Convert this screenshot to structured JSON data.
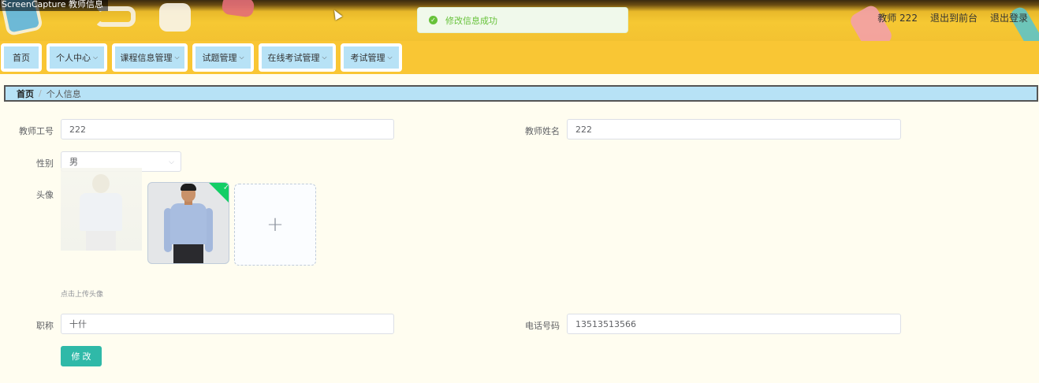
{
  "window": {
    "title": "ScreenCapture 教师信息"
  },
  "toast": {
    "message": "修改信息成功"
  },
  "header": {
    "links": [
      "教师 222",
      "退出到前台",
      "退出登录"
    ]
  },
  "nav": {
    "items": [
      {
        "label": "首页",
        "has_dropdown": false
      },
      {
        "label": "个人中心",
        "has_dropdown": true
      },
      {
        "label": "课程信息管理",
        "has_dropdown": true
      },
      {
        "label": "试题管理",
        "has_dropdown": true
      },
      {
        "label": "在线考试管理",
        "has_dropdown": true
      },
      {
        "label": "考试管理",
        "has_dropdown": true
      }
    ]
  },
  "breadcrumb": {
    "home": "首页",
    "separator": "/",
    "current": "个人信息"
  },
  "form": {
    "teacher_id": {
      "label": "教师工号",
      "value": "222"
    },
    "teacher_name": {
      "label": "教师姓名",
      "value": "222"
    },
    "gender": {
      "label": "性别",
      "value": "男"
    },
    "avatar": {
      "label": "头像",
      "hint": "点击上传头像",
      "add_symbol": "+"
    },
    "title": {
      "label": "职称",
      "value": "十什"
    },
    "phone": {
      "label": "电话号码",
      "value": "13513513566"
    },
    "submit_label": "修 改"
  },
  "colors": {
    "header": "#f6c833",
    "nav_item": "#b7e2f6",
    "submit": "#2fb9a8",
    "success": "#67c23a"
  }
}
